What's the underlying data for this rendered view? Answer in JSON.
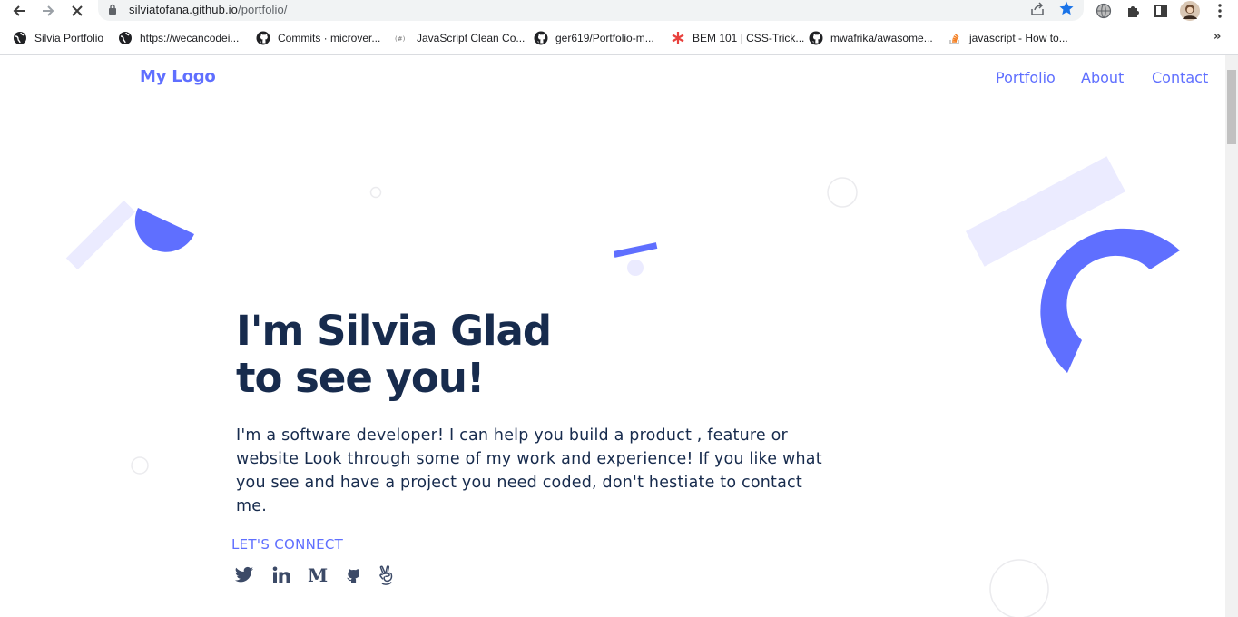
{
  "browser": {
    "url_host": "silviatofana.github.io",
    "url_path": "/portfolio/",
    "bookmarks": [
      {
        "label": "Silvia Portfolio",
        "icon": "globe-icon"
      },
      {
        "label": "https://wecancodei...",
        "icon": "globe-icon"
      },
      {
        "label": "Commits · microver...",
        "icon": "github-icon"
      },
      {
        "label": "JavaScript Clean Co...",
        "icon": "site-icon"
      },
      {
        "label": "ger619/Portfolio-m...",
        "icon": "github-icon"
      },
      {
        "label": "BEM 101 | CSS-Trick...",
        "icon": "asterisk-icon"
      },
      {
        "label": "mwafrika/awasome...",
        "icon": "github-icon"
      },
      {
        "label": "javascript - How to...",
        "icon": "stackoverflow-icon"
      }
    ],
    "more_label": "»"
  },
  "page": {
    "logo": "My Logo",
    "nav": [
      "Portfolio",
      "About",
      "Contact"
    ],
    "hero": {
      "title_line1": "I'm Silvia Glad",
      "title_line2": "to see you!",
      "description": "I'm a software developer! I can help you build a product , feature or website Look through some of my work and experience! If you like what you see and have a project you need coded, don't hestiate to contact me."
    },
    "connect_label": "LET'S CONNECT",
    "social": [
      "twitter-icon",
      "linkedin-icon",
      "medium-icon",
      "github-icon",
      "angellist-icon"
    ]
  },
  "colors": {
    "accent": "#5f6fff",
    "light_accent": "#ebebff",
    "heading": "#172b4d"
  }
}
